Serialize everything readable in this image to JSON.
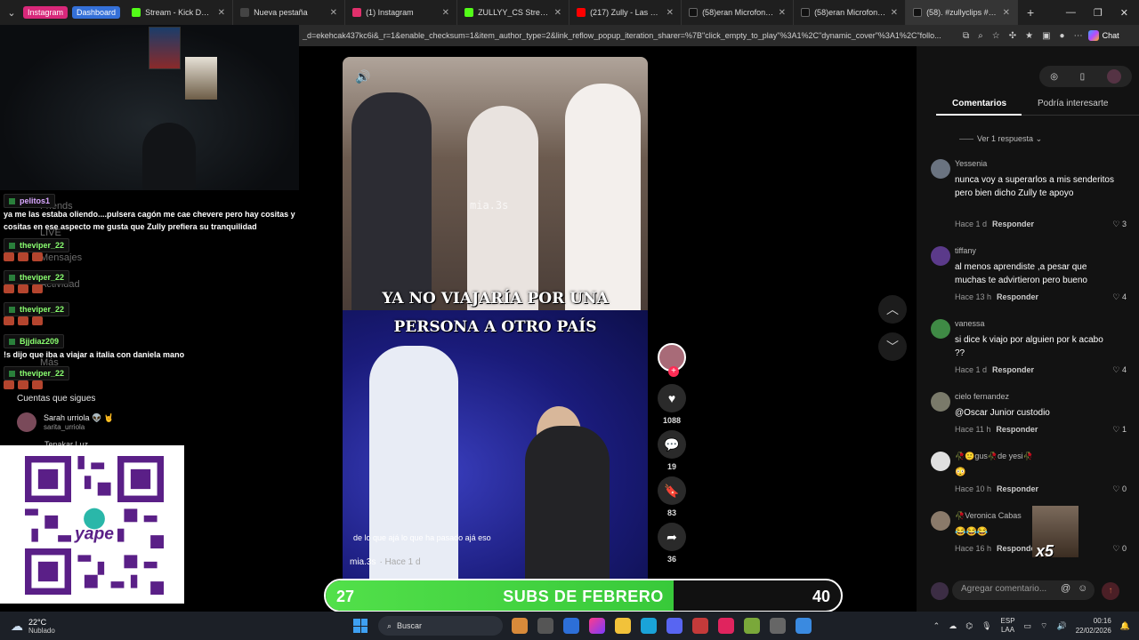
{
  "browser": {
    "pills": [
      "Instagram",
      "Dashboard"
    ],
    "tabs": [
      {
        "title": "Stream - Kick Dashboard",
        "color": "#53fc18"
      },
      {
        "title": "Nueva pestaña",
        "color": "#444"
      },
      {
        "title": "(1) Instagram",
        "color": "#e1306c"
      },
      {
        "title": "ZULLYY_CS Stream - Wa",
        "color": "#53fc18"
      },
      {
        "title": "(217) Zully - Las Bonitas",
        "color": "#ff0000"
      },
      {
        "title": "(58)eran Microfonos*",
        "color": "#111"
      },
      {
        "title": "(58)eran Microfonos*",
        "color": "#111"
      },
      {
        "title": "(58). #zullyclips #zully #",
        "color": "#111"
      }
    ],
    "url": "_d=ekehcak437kc6i&_r=1&enable_checksum=1&item_author_type=2&link_reflow_popup_iteration_sharer=%7B\"click_empty_to_play\"%3A1%2C\"dynamic_cover\"%3A1%2C\"follo...",
    "chat_label": "Chat"
  },
  "stream_chat": [
    {
      "user": "pelitos1",
      "user_color": "#d9a7ff",
      "message": "ya me las estaba oliendo....pulsera cagón me cae chevere pero hay cositas y cositas en ese aspecto me gusta que Zully prefiera su tranquilidad"
    },
    {
      "user": "theviper_22",
      "user_color": "#8aff70",
      "message": ""
    },
    {
      "user": "theviper_22",
      "user_color": "#8aff70",
      "message": ""
    },
    {
      "user": "theviper_22",
      "user_color": "#8aff70",
      "message": ""
    },
    {
      "user": "Bjjdiaz209",
      "user_color": "#8aff70",
      "message": "!s dijo que iba a viajar a italia con daniela mano"
    },
    {
      "user": "theviper_22",
      "user_color": "#8aff70",
      "message": ""
    }
  ],
  "sidebar_ghost": {
    "friends": "Friends",
    "live": "LIVE",
    "messages": "Mensajes",
    "activity": "Actividad",
    "more": "Más"
  },
  "following": {
    "title": "Cuentas que sigues",
    "items": [
      {
        "name": "Sarah urriola 👽 🤘",
        "handle": "sarita_urriola"
      },
      {
        "name": "Tepakar Luz",
        "handle": ""
      }
    ]
  },
  "qr": {
    "brand": "yape"
  },
  "video": {
    "watermark": "mia.3s",
    "caption_line1": "YA NO VIAJARÍA POR UNA",
    "caption_line2": "PERSONA A OTRO PAÍS",
    "subtitle": "de lo que ajá lo que ha pasado ajá eso",
    "author": "mia.3s",
    "time": "· Hace 1 d"
  },
  "actions": {
    "likes": "1088",
    "comments": "19",
    "saves": "83",
    "shares": "36"
  },
  "comments_panel": {
    "tab_comments": "Comentarios",
    "tab_interesting": "Podría interesarte",
    "view_reply": "Ver 1 respuesta",
    "reply_label": "Responder",
    "items": [
      {
        "name": "Yessenia",
        "text": "nunca voy a superarlos a mis senderitos pero bien dicho Zully te apoyo",
        "time": "Hace 1 d",
        "likes": "3",
        "avatar": "#6a7380"
      },
      {
        "name": "tiffany",
        "text": "al menos aprendiste ,a pesar que muchas te advirtieron pero bueno",
        "time": "Hace 13 h",
        "likes": "4",
        "avatar": "#5b3a8a"
      },
      {
        "name": "vanessa",
        "text": "si dice k viajo por alguien por k acabo ??",
        "time": "Hace 1 d",
        "likes": "4",
        "avatar": "#3f8a45"
      },
      {
        "name": "cielo fernandez",
        "text": "@Oscar Junior custodio",
        "time": "Hace 11 h",
        "likes": "1",
        "avatar": "#7a7a6a"
      },
      {
        "name": "🥀🙂gus🥀de yesi🥀",
        "text": "😳",
        "time": "Hace 10 h",
        "likes": "0",
        "avatar": "#e0e0e0"
      },
      {
        "name": "🥀Veronica Cabas",
        "text": "😂😂😂",
        "time": "Hace 16 h",
        "likes": "0",
        "avatar": "#8a7a6a"
      }
    ],
    "add_placeholder": "Agregar comentario...",
    "meme_text": "x5"
  },
  "goal": {
    "current": "27",
    "label": "SUBS DE FEBRERO",
    "target": "40",
    "progress": 0.675
  },
  "taskbar": {
    "temp": "22°C",
    "weather": "Nublado",
    "search": "Buscar",
    "lang1": "ESP",
    "lang2": "LAA",
    "time": "00:16",
    "date": "22/02/2026"
  }
}
